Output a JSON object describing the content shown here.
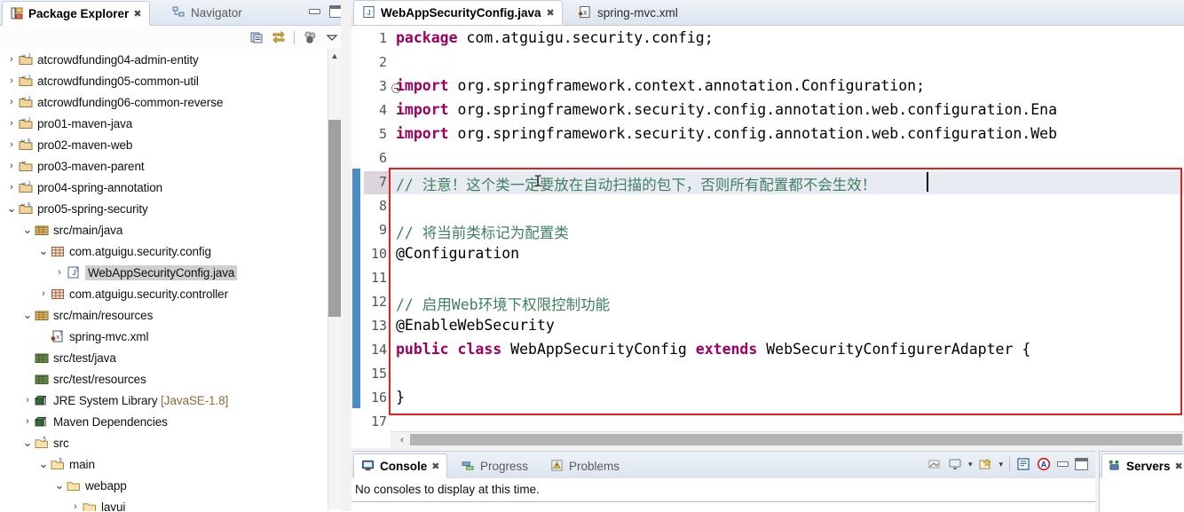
{
  "explorer": {
    "tabs": [
      {
        "label": "Package Explorer",
        "icon": "package-explorer-icon",
        "active": true,
        "close": "✖"
      },
      {
        "label": "Navigator",
        "icon": "navigator-icon",
        "active": false
      }
    ],
    "window_buttons": [
      {
        "name": "minimize-button",
        "label": "Minimize"
      },
      {
        "name": "maximize-button",
        "label": "Maximize"
      }
    ],
    "toolbar": [
      {
        "name": "collapse-all-icon",
        "label": "Collapse All"
      },
      {
        "name": "link-with-editor-icon",
        "label": "Link with Editor"
      },
      {
        "name": "view-menu-filters-icon",
        "label": "Filters"
      },
      {
        "name": "view-menu-icon",
        "label": "View Menu"
      }
    ],
    "tree": [
      {
        "indent": 0,
        "arrow": "›",
        "icon": "maven-java-project-icon",
        "label": "atcrowdfunding04-admin-entity"
      },
      {
        "indent": 0,
        "arrow": "›",
        "icon": "maven-java-project-icon",
        "label": "atcrowdfunding05-common-util"
      },
      {
        "indent": 0,
        "arrow": "›",
        "icon": "maven-java-project-icon",
        "label": "atcrowdfunding06-common-reverse"
      },
      {
        "indent": 0,
        "arrow": "›",
        "icon": "maven-java-project-icon",
        "label": "pro01-maven-java"
      },
      {
        "indent": 0,
        "arrow": "›",
        "icon": "maven-web-project-icon",
        "label": "pro02-maven-web"
      },
      {
        "indent": 0,
        "arrow": "›",
        "icon": "maven-project-icon",
        "label": "pro03-maven-parent"
      },
      {
        "indent": 0,
        "arrow": "›",
        "icon": "maven-java-project-icon",
        "label": "pro04-spring-annotation"
      },
      {
        "indent": 0,
        "arrow": "⌄",
        "icon": "maven-web-project-icon",
        "label": "pro05-spring-security"
      },
      {
        "indent": 1,
        "arrow": "⌄",
        "icon": "source-folder-icon",
        "label": "src/main/java"
      },
      {
        "indent": 2,
        "arrow": "⌄",
        "icon": "package-icon",
        "label": "com.atguigu.security.config"
      },
      {
        "indent": 3,
        "arrow": "›",
        "icon": "java-file-icon",
        "label": "WebAppSecurityConfig.java",
        "selected": true
      },
      {
        "indent": 2,
        "arrow": "›",
        "icon": "package-icon",
        "label": "com.atguigu.security.controller"
      },
      {
        "indent": 1,
        "arrow": "⌄",
        "icon": "source-folder-icon",
        "label": "src/main/resources"
      },
      {
        "indent": 2,
        "arrow": "",
        "icon": "xml-file-icon",
        "label": "spring-mvc.xml"
      },
      {
        "indent": 1,
        "arrow": "",
        "icon": "source-folder-closed-icon",
        "label": "src/test/java"
      },
      {
        "indent": 1,
        "arrow": "",
        "icon": "source-folder-closed-icon",
        "label": "src/test/resources"
      },
      {
        "indent": 1,
        "arrow": "›",
        "icon": "library-icon",
        "label": "JRE System Library ",
        "dim": "[JavaSE-1.8]"
      },
      {
        "indent": 1,
        "arrow": "›",
        "icon": "library-icon",
        "label": "Maven Dependencies"
      },
      {
        "indent": 1,
        "arrow": "⌄",
        "icon": "folder-icon",
        "label": "src"
      },
      {
        "indent": 2,
        "arrow": "⌄",
        "icon": "folder-icon",
        "label": "main"
      },
      {
        "indent": 3,
        "arrow": "⌄",
        "icon": "folder-plain-icon",
        "label": "webapp"
      },
      {
        "indent": 4,
        "arrow": "›",
        "icon": "folder-plain-icon",
        "label": "layui"
      }
    ],
    "scrollbar": {
      "name": "explorer-vertical-scrollbar",
      "up_arrow": "▲"
    }
  },
  "editor": {
    "tabs": [
      {
        "label": "WebAppSecurityConfig.java",
        "icon": "java-file-icon",
        "active": true,
        "close": "✖"
      },
      {
        "label": "spring-mvc.xml",
        "icon": "xml-file-icon",
        "active": false
      }
    ],
    "lines": [
      {
        "n": "1",
        "html": "<span class=\"kw\">package</span> com.atguigu.security.config;"
      },
      {
        "n": "2",
        "html": ""
      },
      {
        "n": "3",
        "html": "<span class=\"kw\">import</span> org.springframework.context.annotation.Configuration;",
        "fold": true
      },
      {
        "n": "4",
        "html": "<span class=\"kw\">import</span> org.springframework.security.config.annotation.web.configuration.Ena"
      },
      {
        "n": "5",
        "html": "<span class=\"kw\">import</span> org.springframework.security.config.annotation.web.configuration.Web"
      },
      {
        "n": "6",
        "html": ""
      },
      {
        "n": "7",
        "html": "<span class=\"cmt\">// 注意！这个类一定要放在自动扫描的包下，否则所有配置都不会生效！</span>",
        "current": true
      },
      {
        "n": "8",
        "html": ""
      },
      {
        "n": "9",
        "html": "<span class=\"cmt\">// 将当前类标记为配置类</span>"
      },
      {
        "n": "10",
        "html": "@Configuration"
      },
      {
        "n": "11",
        "html": ""
      },
      {
        "n": "12",
        "html": "<span class=\"cmt\">// 启用Web环境下权限控制功能</span>"
      },
      {
        "n": "13",
        "html": "@EnableWebSecurity"
      },
      {
        "n": "14",
        "html": "<span class=\"kw\">public</span> <span class=\"kw\">class</span> WebAppSecurityConfig <span class=\"kw\">extends</span> WebSecurityConfigurerAdapter {"
      },
      {
        "n": "15",
        "html": ""
      },
      {
        "n": "16",
        "html": "}"
      },
      {
        "n": "17",
        "html": ""
      }
    ],
    "annotation": {
      "name": "red-highlight-box",
      "color": "#f01a1a"
    },
    "changed_marker_color": "#4a8cc7",
    "hscrollbar": {
      "name": "editor-horizontal-scrollbar",
      "left_arrow": "‹"
    }
  },
  "console": {
    "tabs": [
      {
        "label": "Console",
        "icon": "console-icon",
        "active": true,
        "close": "✖"
      },
      {
        "label": "Progress",
        "icon": "progress-icon",
        "active": false
      },
      {
        "label": "Problems",
        "icon": "problems-icon",
        "active": false
      }
    ],
    "toolbar": [
      {
        "name": "clear-console-icon",
        "label": "Clear Console"
      },
      {
        "name": "display-selected-console-icon",
        "label": "Display Selected Console"
      },
      {
        "name": "display-selected-console-dropdown-icon",
        "label": "▾"
      },
      {
        "name": "open-console-icon",
        "label": "Open Console"
      },
      {
        "name": "open-console-dropdown-icon",
        "label": "▾"
      },
      {
        "name": "word-wrap-icon",
        "label": "Word Wrap"
      },
      {
        "name": "ansi-console-icon",
        "label": "ANSI Console"
      },
      {
        "name": "minimize-button",
        "label": "Minimize"
      },
      {
        "name": "maximize-button",
        "label": "Maximize"
      }
    ],
    "message": "No consoles to display at this time."
  },
  "servers": {
    "tabs": [
      {
        "label": "Servers",
        "icon": "servers-icon",
        "active": true,
        "close": "✖"
      }
    ]
  }
}
